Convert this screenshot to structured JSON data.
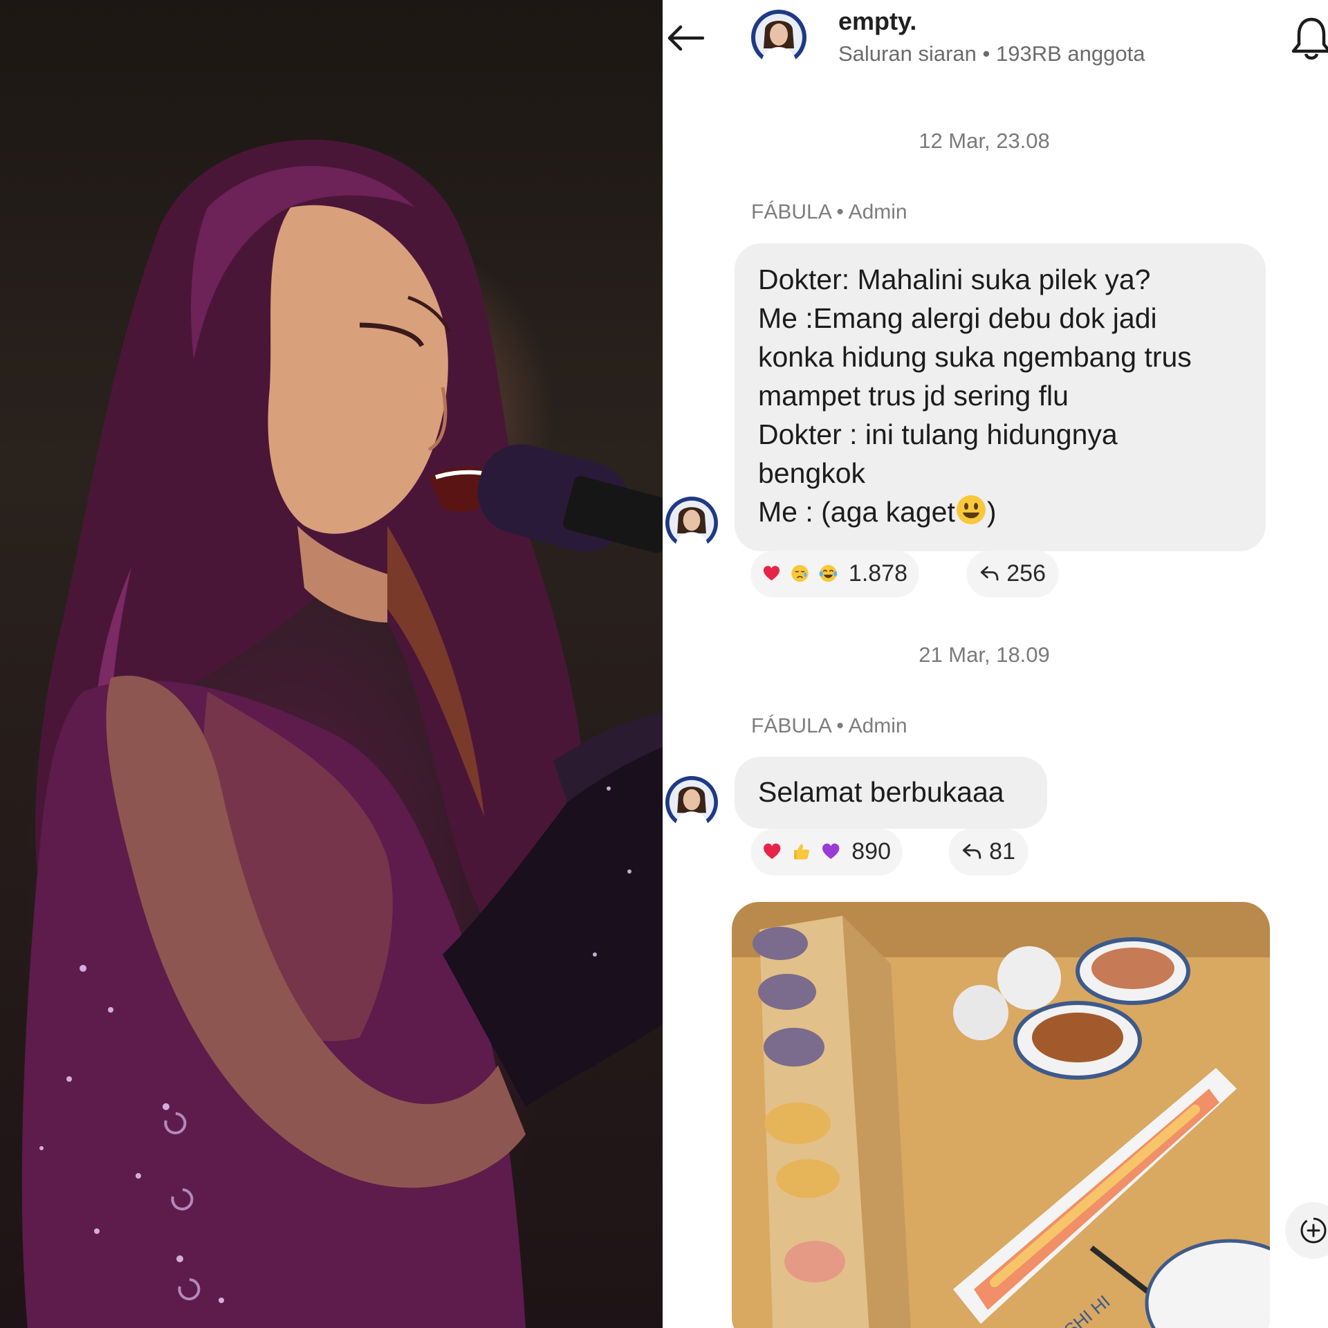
{
  "header": {
    "channel_name": "empty.",
    "channel_meta": "Saluran siaran • 193RB anggota",
    "back_icon": "arrow-left-icon",
    "bell_icon": "bell-icon"
  },
  "messages": [
    {
      "date": "12 Mar, 23.08",
      "sender": "FÁBULA • Admin",
      "lines": [
        "Dokter: Mahalini suka pilek ya?",
        "Me :Emang alergi debu dok jadi",
        "konka hidung suka ngembang trus",
        "mampet trus jd sering flu",
        "Dokter : ini tulang hidungnya",
        "bengkok",
        "Me : (aga kaget",
        ")"
      ],
      "inline_emoji": "smiling-face-emoji",
      "reactions": {
        "emojis": [
          "red-heart-emoji",
          "sad-relieved-face-emoji",
          "tears-of-joy-emoji"
        ],
        "count": "1.878"
      },
      "shares": "256"
    },
    {
      "date": "21 Mar, 18.09",
      "sender": "FÁBULA • Admin",
      "text": "Selamat berbukaaa",
      "reactions": {
        "emojis": [
          "red-heart-emoji",
          "thumbs-up-emoji",
          "purple-heart-emoji"
        ],
        "count": "890"
      },
      "shares": "81",
      "photo_text": "SHI HI"
    }
  ],
  "colors": {
    "bubble": "#efefef",
    "secondary_text": "#7a7a7a",
    "heart_red": "#e8234a",
    "heart_purple": "#9b3bd6"
  }
}
